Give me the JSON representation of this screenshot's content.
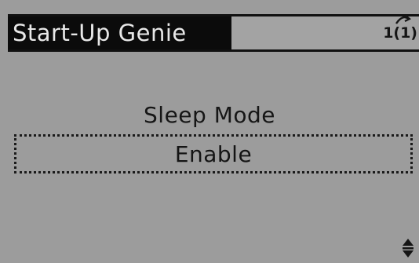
{
  "header": {
    "title": "Start-Up Genie",
    "page_indicator": "1(1)"
  },
  "parameter": {
    "label": "Sleep Mode",
    "value": "Enable"
  },
  "icons": {
    "page_arrow": "curved-arrow-icon",
    "scroll": "up-down-arrow-icon"
  },
  "colors": {
    "screen_background": "#9c9c9c",
    "title_background": "#0b0b0b",
    "title_text": "#e8e8e8",
    "text": "#111111"
  }
}
